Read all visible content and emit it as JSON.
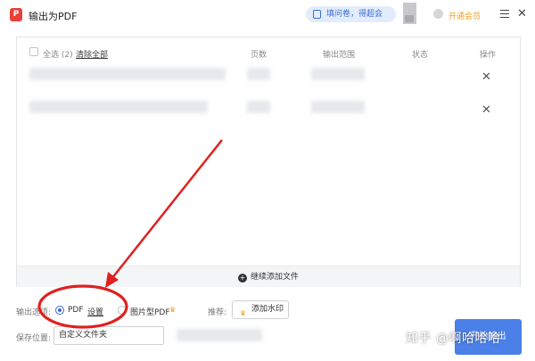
{
  "window": {
    "title": "输出为PDF",
    "survey_label": "填问卷，得超会",
    "member_label": "开通会员"
  },
  "table": {
    "select_all": "全选 (2)",
    "clear_all": "清除全部",
    "headers": {
      "pages": "页数",
      "range": "输出范围",
      "status": "状态",
      "action": "操作"
    },
    "rows": [
      {
        "remove_icon": "close-icon"
      },
      {
        "remove_icon": "close-icon"
      }
    ]
  },
  "add_more_label": "继续添加文件",
  "options": {
    "output_label": "输出选项:",
    "pdf_label": "PDF",
    "settings_label": "设置",
    "image_pdf_label": "图片型PDF",
    "recommend_label": "推荐:",
    "watermark_label": "添加水印",
    "save_label": "保存位置:",
    "folder_value": "自定义文件夹"
  },
  "start_label": "开始输出",
  "overlay_watermark": "知乎 @啊哈哈哈",
  "colors": {
    "accent": "#3a6bd8",
    "annotation": "#e02020",
    "member": "#f0a020"
  }
}
